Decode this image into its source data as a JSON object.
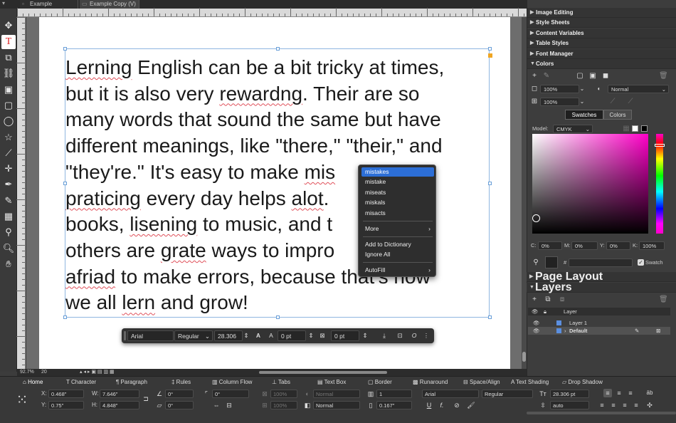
{
  "tabs": [
    {
      "label": "Example"
    },
    {
      "label": "Example Copy (V)"
    }
  ],
  "document": {
    "lines": [
      [
        {
          "t": "Lerning",
          "e": true
        },
        {
          "t": " English can be a bit tricky at times,"
        }
      ],
      [
        {
          "t": "but it is also very "
        },
        {
          "t": "rewardng",
          "e": true
        },
        {
          "t": ". Their are so"
        }
      ],
      [
        {
          "t": "many words that sound the same but have"
        }
      ],
      [
        {
          "t": "different meanings, like \"there,\" \"their,\" and"
        }
      ],
      [
        {
          "t": "\"they're.\" It's easy to make "
        },
        {
          "t": "mis",
          "e": true
        },
        {
          "t": "            t"
        }
      ],
      [
        {
          "t": "praticing",
          "e": true
        },
        {
          "t": " every day helps "
        },
        {
          "t": "alot",
          "e": true
        },
        {
          "t": ".              g"
        }
      ],
      [
        {
          "t": "books, "
        },
        {
          "t": "lisening",
          "e": true
        },
        {
          "t": " to music, and t          ith"
        }
      ],
      [
        {
          "t": "others are "
        },
        {
          "t": "grate",
          "e": true
        },
        {
          "t": " ways to impro           't be"
        }
      ],
      [
        {
          "t": "afriad",
          "e": true
        },
        {
          "t": " to make errors, because that's how"
        }
      ],
      [
        {
          "t": "we all "
        },
        {
          "t": "lern",
          "e": true
        },
        {
          "t": " and grow!"
        }
      ]
    ]
  },
  "context_menu": {
    "suggestions": [
      "mistakes",
      "mistake",
      "miseats",
      "miskals",
      "misacts"
    ],
    "more": "More",
    "add_to_dictionary": "Add to Dictionary",
    "ignore_all": "Ignore All",
    "autofill": "AutoFill"
  },
  "floating_toolbar": {
    "font": "Arial",
    "style": "Regular",
    "size": "28.306",
    "tracking": "0 pt",
    "baseline": "0 pt"
  },
  "status": {
    "zoom": "92.7%",
    "page": "20"
  },
  "right_panel": {
    "sections_top": [
      "Image Editing",
      "Style Sheets",
      "Content Variables",
      "Table Styles",
      "Font Manager"
    ],
    "colors": {
      "title": "Colors",
      "fill_opacity": "100%",
      "blend": "Normal",
      "stroke_opacity": "100%",
      "tab_swatches": "Swatches",
      "tab_colors": "Colors",
      "model_label": "Model:",
      "model": "CMYK",
      "c_label": "C:",
      "c": "0%",
      "m_label": "M:",
      "m": "0%",
      "y_label": "Y:",
      "y": "0%",
      "k_label": "K:",
      "k": "100%",
      "hash": "#",
      "swatch_label": "Swatch"
    },
    "page_layout": "Page Layout",
    "layers": {
      "title": "Layers",
      "header": "Layer",
      "rows": [
        "Layer 1",
        "Default"
      ]
    }
  },
  "bottom_tabs": [
    "Home",
    "Character",
    "Paragraph",
    "Rules",
    "Column Flow",
    "Tabs",
    "Text Box",
    "Border",
    "Runaround",
    "Space/Align",
    "Text Shading",
    "Drop Shadow"
  ],
  "measurements": {
    "x_label": "X:",
    "x": "0.468\"",
    "y_label": "Y:",
    "y": "0.75\"",
    "w_label": "W:",
    "w": "7.646\"",
    "h_label": "H:",
    "h": "4.848\"",
    "angle": "0°",
    "skew": "0°",
    "corner": "0°",
    "opacity1": "100%",
    "opacity2": "100%",
    "blend1": "Normal",
    "blend2": "Normal",
    "columns": "1",
    "gutter": "0.167\"",
    "font": "Arial",
    "style": "Regular",
    "size": "28.306 pt",
    "leading": "auto"
  }
}
